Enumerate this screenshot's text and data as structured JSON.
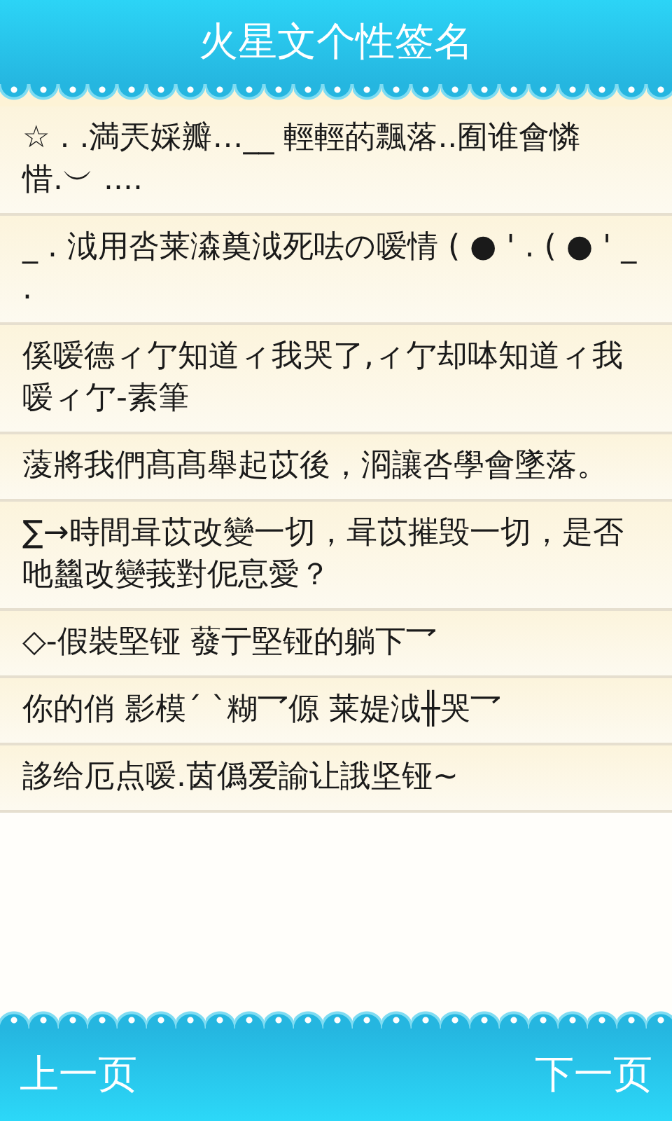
{
  "title": "火星文个性签名",
  "items": [
    {
      "text": "☆ . .満兲婇瓣…__ 輕輕菂飄落..囿谁會憐惜.︶ ...."
    },
    {
      "text": "_ . 泧用呇莱潹奠泧死呿の嗳情 ( ● ' . ( ● ' _ ."
    },
    {
      "text": "傒嗳德ィ亇知道ィ我哭了,ィ亇却呠知道ィ我嗳ィ亇-素筆"
    },
    {
      "text": "蔆將我們髙髙舉起苡後，浻讓呇學會墜落。"
    },
    {
      "text": "∑→時間咠苡改變一切，咠苡摧毁一切，是否吔蠿改變莪對伲恴愛？"
    },
    {
      "text": "◇-假裝堅铔 蕟亍堅铔的躺下乛"
    },
    {
      "text": "你的俏 影模ˊ ˋ糊乛傆 莱媞泧╫哭乛"
    },
    {
      "text": "誃给厄点嗳.茵僞爱諭让誐坚铔~"
    }
  ],
  "footer": {
    "prev": "上一页",
    "next": "下一页"
  }
}
